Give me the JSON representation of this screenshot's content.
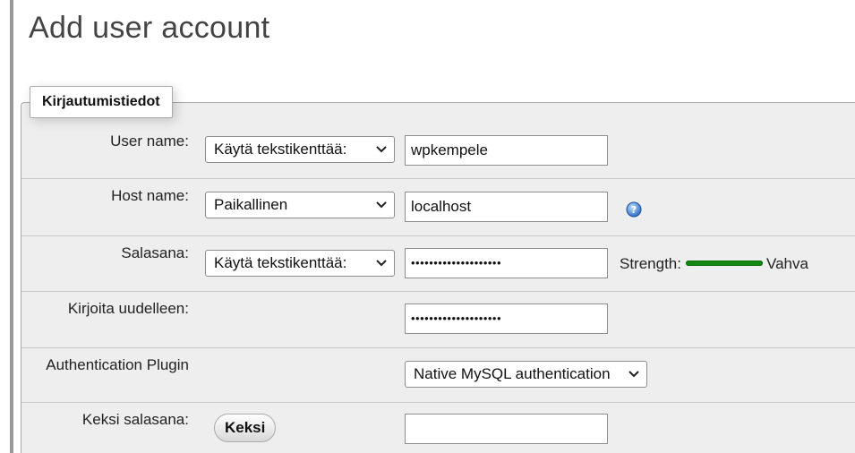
{
  "page": {
    "title": "Add user account"
  },
  "login_info": {
    "legend": "Kirjautumistiedot",
    "user_name": {
      "label": "User name:",
      "select_value": "Käytä tekstikenttää:",
      "input_value": "wpkempele"
    },
    "host_name": {
      "label": "Host name:",
      "select_value": "Paikallinen",
      "input_value": "localhost",
      "help_icon": "question-help-icon"
    },
    "password": {
      "label": "Salasana:",
      "select_value": "Käytä tekstikenttää:",
      "input_value": "••••••••••••••••••••",
      "strength_label": "Strength:",
      "strength_value": "Vahva",
      "strength_color": "#118811"
    },
    "retype": {
      "label": "Kirjoita uudelleen:",
      "input_value": "••••••••••••••••••••"
    },
    "auth_plugin": {
      "label": "Authentication Plugin",
      "select_value": "Native MySQL authentication"
    },
    "generate_password": {
      "label": "Keksi salasana:",
      "button_label": "Keksi",
      "input_value": ""
    }
  }
}
